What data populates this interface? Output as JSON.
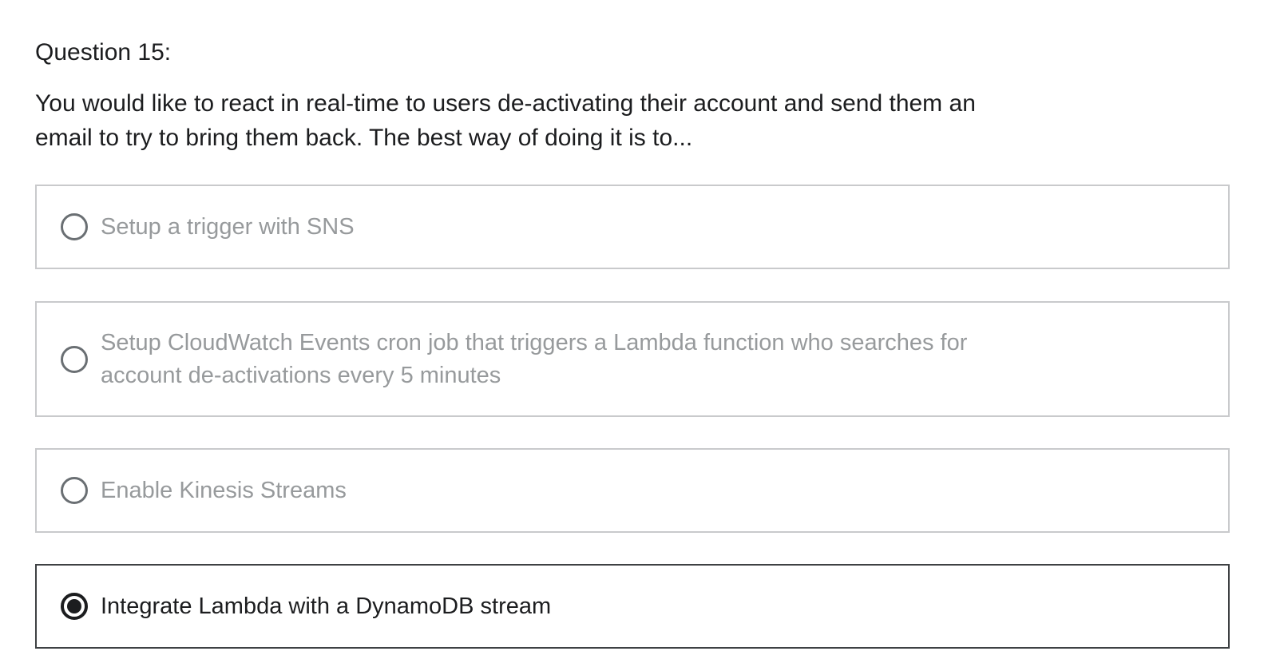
{
  "question": {
    "number_label": "Question 15:",
    "text": "You would like to react in real-time to users de-activating their account and send them an email to try to bring them back. The best way of doing it is to..."
  },
  "options": [
    {
      "label": "Setup a trigger with SNS",
      "selected": false
    },
    {
      "label": "Setup CloudWatch Events cron job that triggers a Lambda function who searches for account de-activations every 5 minutes",
      "selected": false
    },
    {
      "label": "Enable Kinesis Streams",
      "selected": false
    },
    {
      "label": "Integrate Lambda with a DynamoDB stream",
      "selected": true
    }
  ],
  "colors": {
    "text_primary": "#1c1d1f",
    "text_muted": "#979a9c",
    "border_default": "#c9cacc",
    "border_selected": "#3e4143"
  }
}
